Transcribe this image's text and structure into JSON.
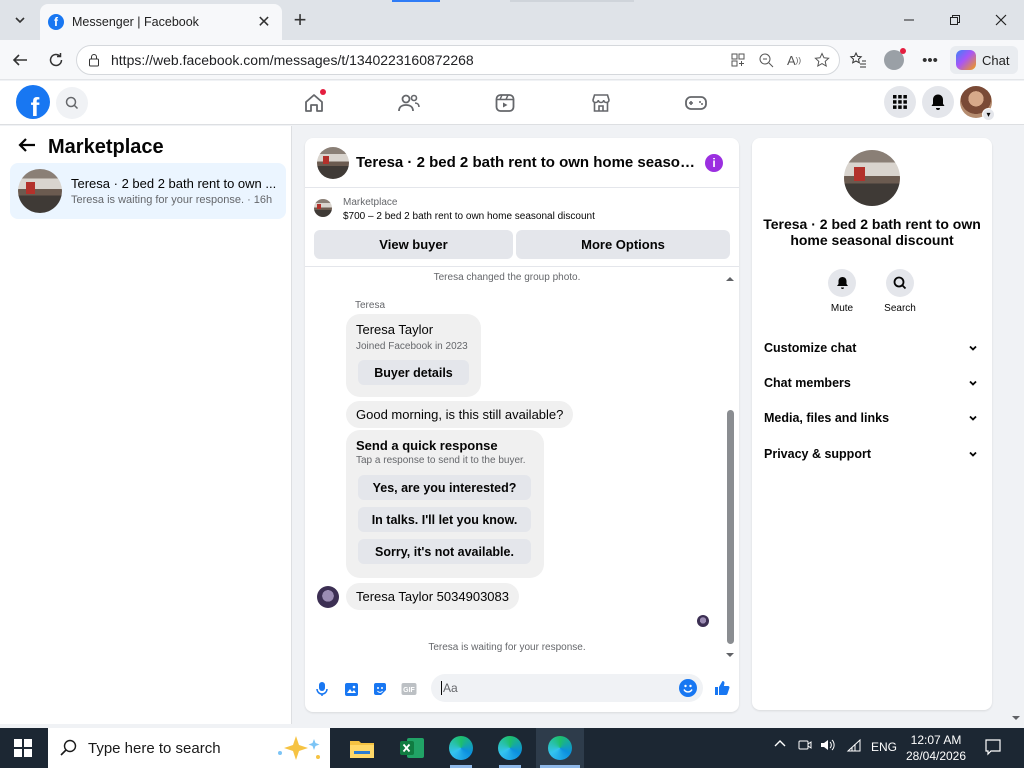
{
  "browser": {
    "tab_title": "Messenger | Facebook",
    "url": "https://web.facebook.com/messages/t/1340223160872268",
    "chat_label": "Chat"
  },
  "left_panel": {
    "header": "Marketplace",
    "conversation": {
      "title": "Teresa · 2 bed 2 bath rent to own ...",
      "subtitle": "Teresa is waiting for your response. · 16h"
    }
  },
  "chat": {
    "header_title": "Teresa · 2 bed 2 bath rent to own home seasonal dis...",
    "marketplace_label": "Marketplace",
    "listing": "$700 – 2 bed 2 bath rent to own home seasonal discount",
    "view_buyer": "View buyer",
    "more_options": "More Options",
    "system_group_photo": "Teresa changed the group photo.",
    "sender_name": "Teresa",
    "profile_card": {
      "name": "Teresa Taylor",
      "joined": "Joined Facebook in 2023",
      "button": "Buyer details"
    },
    "message_1": "Good morning, is this still available?",
    "quick_response": {
      "title": "Send a quick response",
      "subtitle": "Tap a response to send it to the buyer.",
      "options": [
        "Yes, are you interested?",
        "In talks. I'll let you know.",
        "Sorry, it's not available."
      ]
    },
    "message_2": "Teresa Taylor 5034903083",
    "system_waiting": "Teresa is waiting for your response.",
    "composer_placeholder": "Aa"
  },
  "right_panel": {
    "title": "Teresa · 2 bed 2 bath rent to own home seasonal discount",
    "mute_label": "Mute",
    "search_label": "Search",
    "sections": [
      "Customize chat",
      "Chat members",
      "Media, files and links",
      "Privacy & support"
    ]
  },
  "taskbar": {
    "search_placeholder": "Type here to search",
    "language": "ENG",
    "time": "12:07 AM",
    "date": "28/04/2026"
  },
  "colors": {
    "facebook_blue": "#1877f2",
    "selected_convo_bg": "#ebf5ff",
    "info_purple": "#9b2fe0",
    "notification_red": "#e41e3f"
  }
}
